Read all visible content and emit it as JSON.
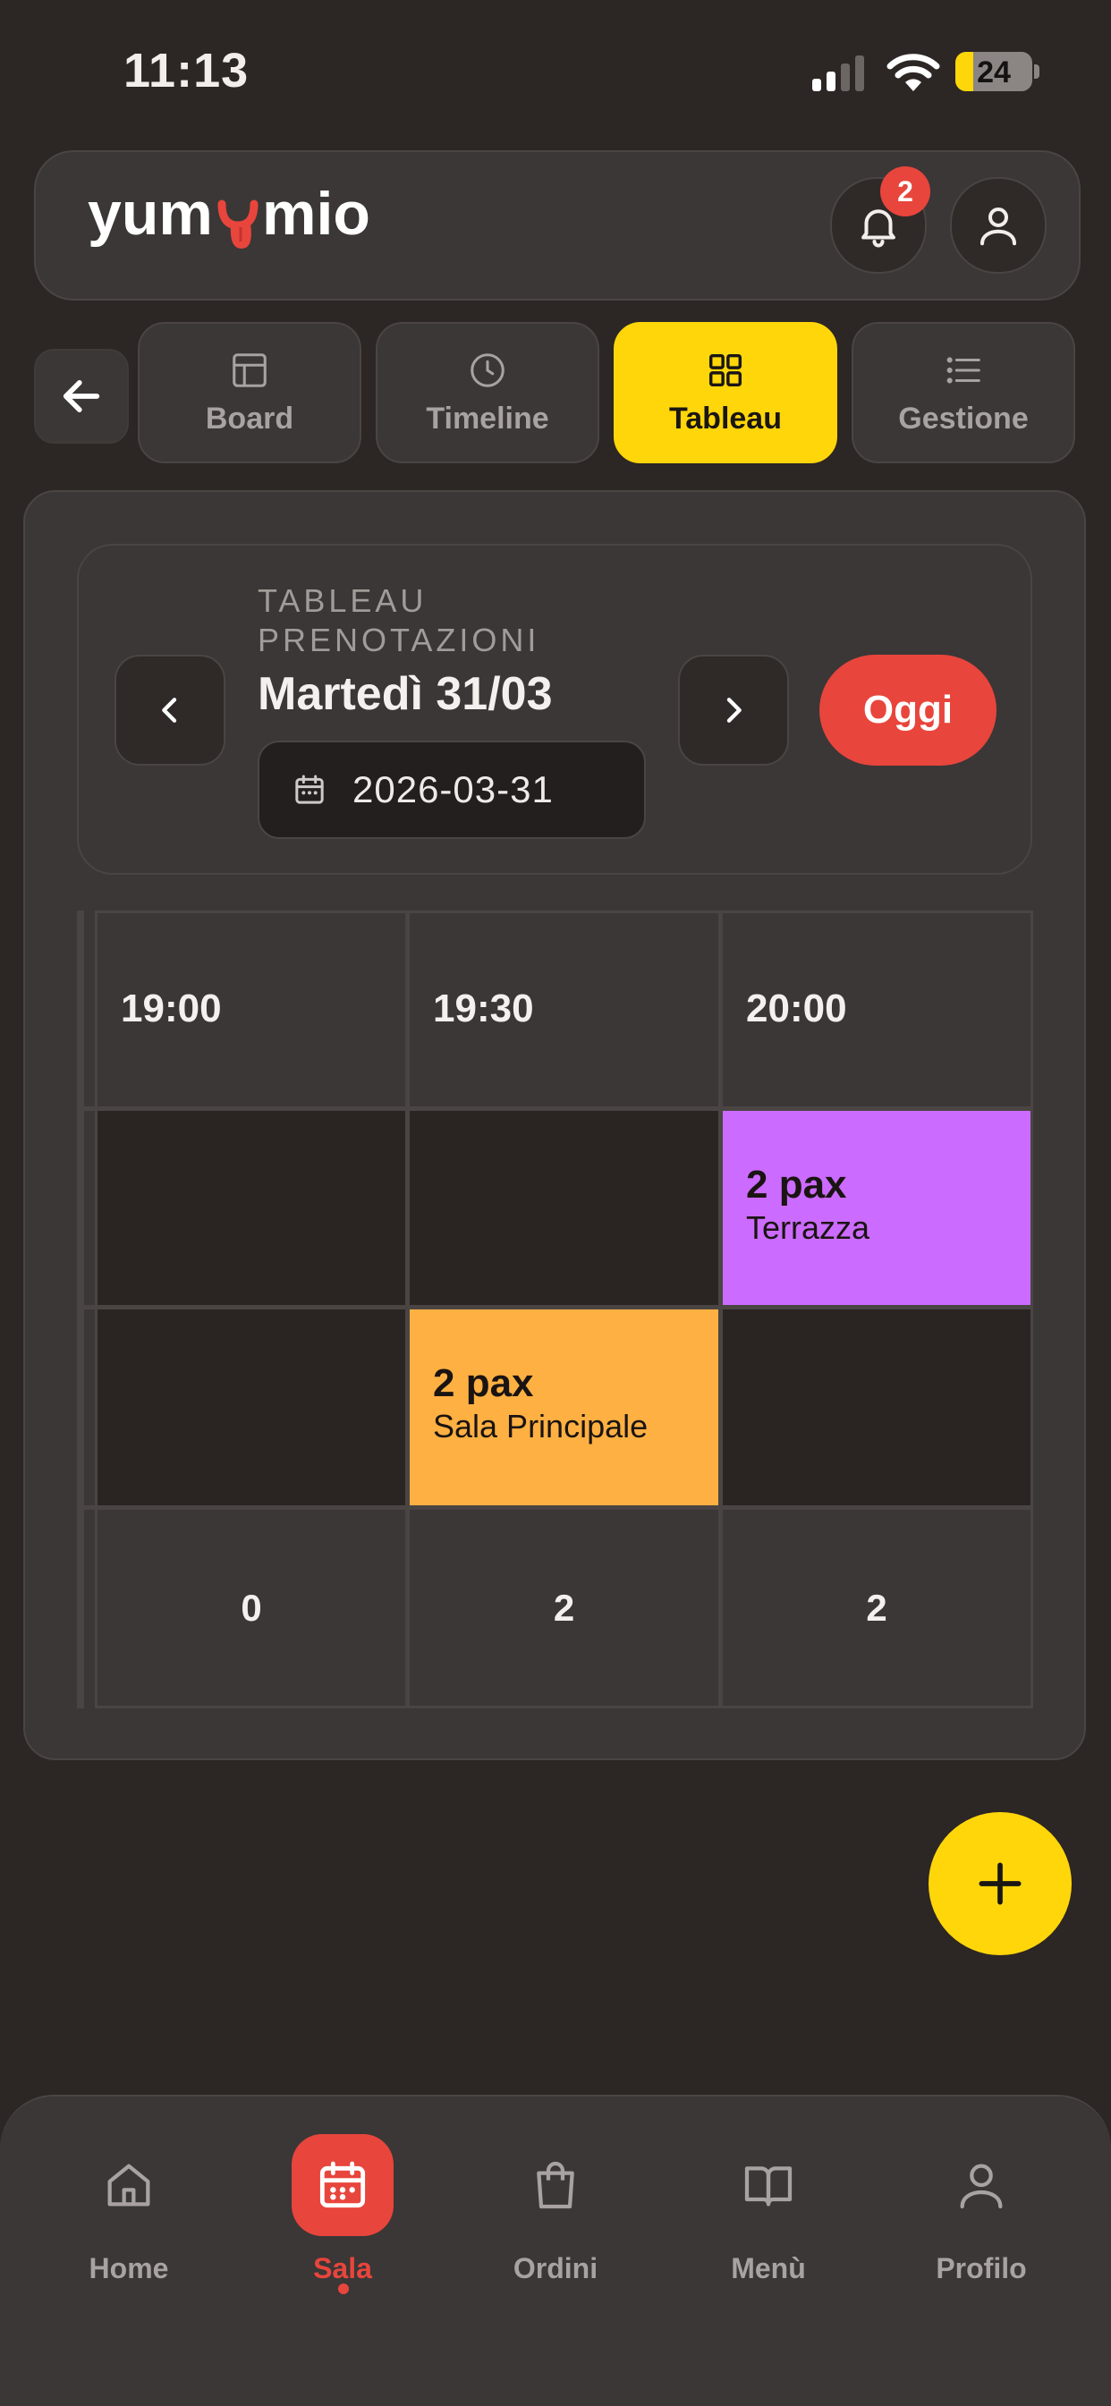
{
  "status_bar": {
    "time": "11:13",
    "battery": "24"
  },
  "header": {
    "logo_text": "yum mio",
    "notification_count": "2"
  },
  "tabs": [
    {
      "label": "Board",
      "icon": "board-icon",
      "active": false
    },
    {
      "label": "Timeline",
      "icon": "clock-icon",
      "active": false
    },
    {
      "label": "Tableau",
      "icon": "grid-icon",
      "active": true
    },
    {
      "label": "Gestione",
      "icon": "list-icon",
      "active": false
    }
  ],
  "date_card": {
    "kicker": "TABLEAU PRENOTAZIONI",
    "title": "Martedì 31/03",
    "date_value": "2026-03-31",
    "today_label": "Oggi"
  },
  "tableau": {
    "time_slots": [
      "19:00",
      "19:30",
      "20:00"
    ],
    "reservations": [
      {
        "pax": "2 pax",
        "room": "Terrazza",
        "color": "#cc6bff"
      },
      {
        "pax": "2 pax",
        "room": "Sala Principale",
        "color": "#ffb042"
      }
    ],
    "totals": [
      "0",
      "2",
      "2"
    ]
  },
  "bottom_nav": [
    {
      "label": "Home",
      "icon": "home-icon",
      "active": false
    },
    {
      "label": "Sala",
      "icon": "calendar-icon",
      "active": true
    },
    {
      "label": "Ordini",
      "icon": "bag-icon",
      "active": false
    },
    {
      "label": "Menù",
      "icon": "book-icon",
      "active": false
    },
    {
      "label": "Profilo",
      "icon": "user-icon",
      "active": false
    }
  ],
  "colors": {
    "accent_yellow": "#ffd60a",
    "accent_red": "#e8453c",
    "background": "#2c2624"
  }
}
